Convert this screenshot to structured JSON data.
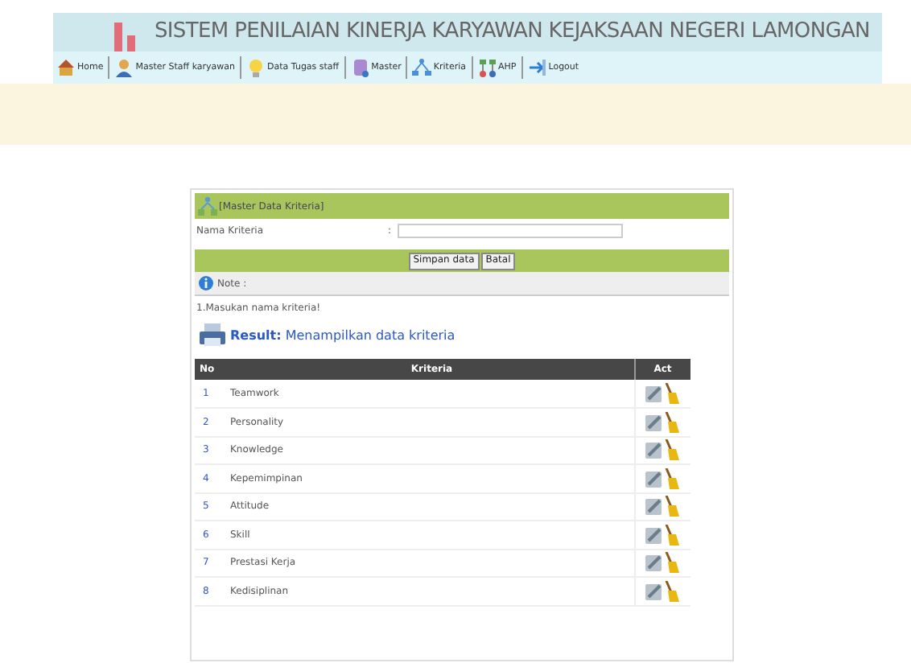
{
  "header": {
    "title": "SISTEM PENILAIAN KINERJA KARYAWAN KEJAKSAAN NEGERI LAMONGAN"
  },
  "menu": [
    {
      "label": "Home"
    },
    {
      "label": "Master Staff karyawan"
    },
    {
      "label": "Data Tugas staff"
    },
    {
      "label": "Master"
    },
    {
      "label": "Kriteria"
    },
    {
      "label": "AHP"
    },
    {
      "label": "Logout"
    }
  ],
  "form": {
    "title": "[Master Data Kriteria]",
    "field_label": "Nama Kriteria",
    "separator": ":",
    "buttons": [
      "Simpan data",
      "Batal"
    ]
  },
  "note": {
    "label": "Note :",
    "text": "1.Masukan nama kriteria!"
  },
  "result": {
    "label": "Result:",
    "text": "Menampilkan data kriteria"
  },
  "table": {
    "columns": [
      "No",
      "Kriteria",
      "Act"
    ],
    "rows": [
      {
        "no": "1",
        "name": "Teamwork"
      },
      {
        "no": "2",
        "name": "Personality"
      },
      {
        "no": "3",
        "name": "Knowledge"
      },
      {
        "no": "4",
        "name": "Kepemimpinan"
      },
      {
        "no": "5",
        "name": "Attitude"
      },
      {
        "no": "6",
        "name": "Skill"
      },
      {
        "no": "7",
        "name": "Prestasi Kerja"
      },
      {
        "no": "8",
        "name": "Kedisiplinan"
      }
    ]
  }
}
